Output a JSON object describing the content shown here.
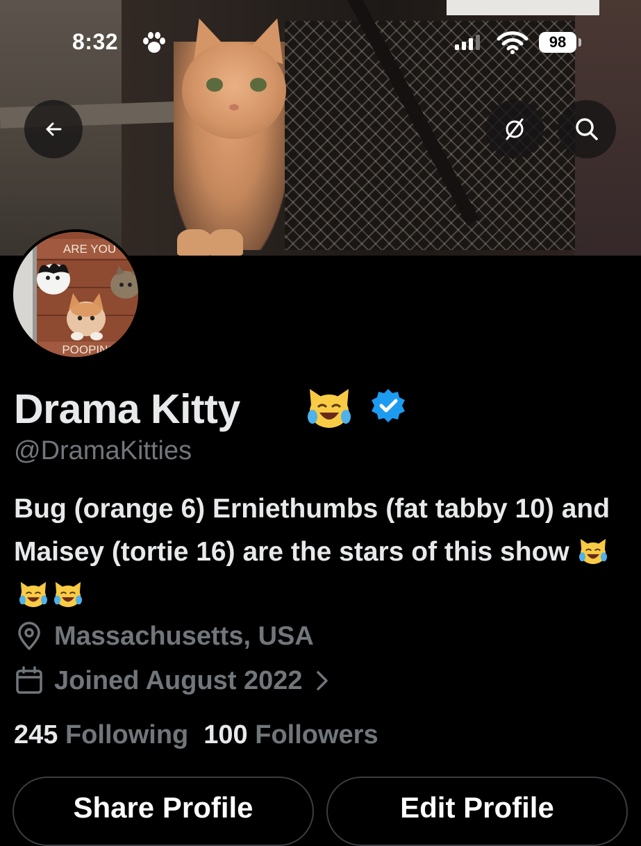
{
  "status_bar": {
    "time": "8:32",
    "battery": "98"
  },
  "header": {
    "back_icon": "arrow-left-icon",
    "incognito_icon": "eye-slash-icon",
    "search_icon": "search-icon"
  },
  "banner": {
    "description_icon": "banner-photo"
  },
  "avatar": {
    "top_text": "ARE YOU",
    "bottom_text": "POOPING"
  },
  "profile": {
    "display_name": "Drama Kitty",
    "handle": "@DramaKitties",
    "bio": "Bug (orange 6) Erniethumbs (fat tabby 10) and Maisey (tortie 16) are the stars of this show",
    "location": "Massachusetts, USA",
    "joined": "Joined August 2022",
    "following_count": "245",
    "following_label": "Following",
    "followers_count": "100",
    "followers_label": "Followers"
  },
  "buttons": {
    "share": "Share Profile",
    "edit": "Edit Profile"
  },
  "colors": {
    "background": "#000000",
    "primary_text": "#e7e9ea",
    "secondary_text": "#71767b",
    "verified": "#1d9bf0"
  }
}
